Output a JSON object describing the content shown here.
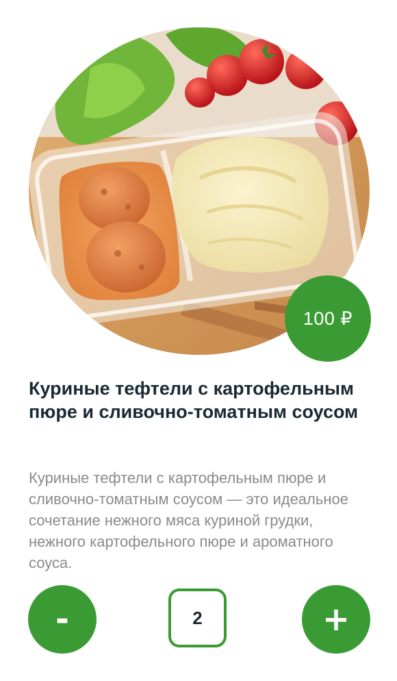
{
  "product": {
    "image_alt": "Куриные тефтели с картофельным пюре и сливочно-томатным соусом",
    "price": "100 ₽",
    "title": "Куриные тефтели с картофельным пюре и сливочно-томатным соусом",
    "description": "Куриные тефтели с картофельным пюре и сливочно-томатным соусом — это идеальное сочетание нежного мяса куриной грудки, нежного картофельного пюре и ароматного соуса."
  },
  "quantity": {
    "decrement_label": "-",
    "value": "2",
    "increment_label": "+"
  },
  "colors": {
    "accent": "#3a9b34",
    "title_text": "#1a2a33",
    "description_text": "#8a8a8a"
  }
}
